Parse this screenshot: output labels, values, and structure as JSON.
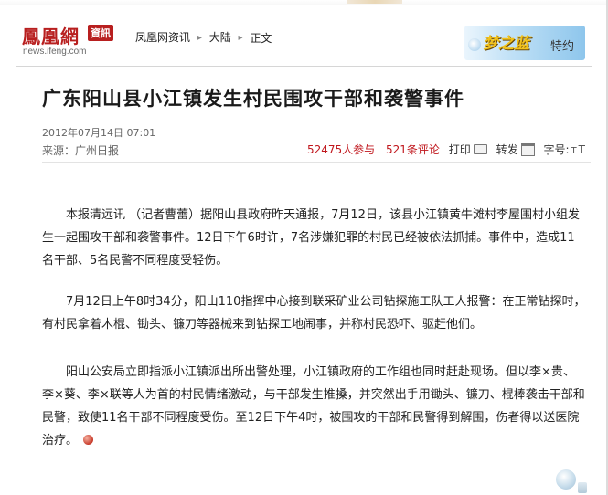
{
  "header": {
    "logo_cn": "鳳凰網",
    "logo_badge": "資訊",
    "logo_url": "news.ifeng.com",
    "breadcrumb": [
      "凤凰网资讯",
      "大陆",
      "正文"
    ],
    "banner_title": "梦之蓝",
    "banner_sub": "特约"
  },
  "article": {
    "title": "广东阳山县小江镇发生村民围攻干部和袭警事件",
    "date": "2012年07月14日 07:01",
    "source": "来源：广州日报",
    "participants": "52475人参与",
    "comments": "521条评论",
    "print_label": "打印",
    "share_label": "转发",
    "font_size_label": "字号:",
    "font_size_options": [
      "T",
      "T"
    ],
    "paragraphs": [
      "本报清远讯 （记者曹蕾）据阳山县政府昨天通报，7月12日，该县小江镇黄牛滩村李屋围村小组发生一起围攻干部和袭警事件。12日下午6时许，7名涉嫌犯罪的村民已经被依法抓捕。事件中，造成11名干部、5名民警不同程度受轻伤。",
      "7月12日上午8时34分，阳山110指挥中心接到联采矿业公司钻探施工队工人报警：在正常钻探时，有村民拿着木棍、锄头、镰刀等器械来到钻探工地闹事，并称村民恐吓、驱赶他们。",
      "阳山公安局立即指派小江镇派出所出警处理，小江镇政府的工作组也同时赶赴现场。但以李×贵、李×葵、李×联等人为首的村民情绪激动，与干部发生推搡，并突然出手用锄头、镰刀、棍棒袭击干部和民警，致使11名干部不同程度受伤。至12日下午4时，被围攻的干部和民警得到解围，伤者得以送医院治疗。"
    ]
  },
  "icons": [
    "print-icon",
    "share-icon",
    "swirl-icon"
  ],
  "colors": {
    "brand_red": "#b81f1f",
    "count_red": "#c0161c"
  }
}
